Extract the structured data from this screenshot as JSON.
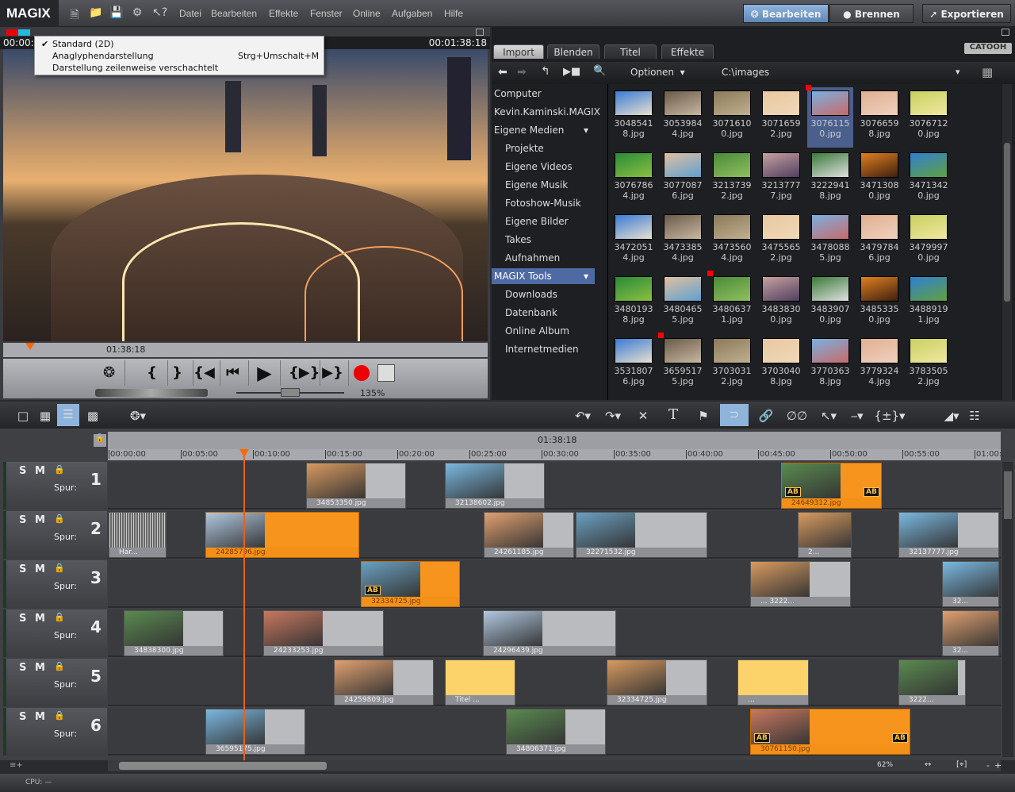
{
  "app": {
    "logo": "MAGIX"
  },
  "menu": [
    "Datei",
    "Bearbeiten",
    "Effekte",
    "Fenster",
    "Online",
    "Aufgaben",
    "Hilfe"
  ],
  "modes": {
    "edit": "Bearbeiten",
    "burn": "Brennen",
    "export": "Exportieren"
  },
  "preview": {
    "timecode_left": "00:00:0",
    "timecode_right": "00:01:38:18",
    "mini_timeline_time": "01:38:18",
    "zoom": "135%"
  },
  "stereo_menu": {
    "items": [
      {
        "label": "Standard (2D)",
        "checked": true,
        "shortcut": ""
      },
      {
        "label": "Anaglyphendarstellung",
        "checked": false,
        "shortcut": "Strg+Umschalt+M"
      },
      {
        "label": "Darstellung zeilenweise verschachtelt",
        "checked": false,
        "shortcut": ""
      }
    ]
  },
  "browser": {
    "tabs": [
      "Import",
      "Blenden",
      "Titel",
      "Effekte"
    ],
    "active_tab": "Import",
    "brand": "CATOOH",
    "options_label": "Optionen",
    "path": "C:\\images",
    "tree": [
      {
        "label": "Computer",
        "indent": 0
      },
      {
        "label": "Kevin.Kaminski.MAGIX",
        "indent": 0
      },
      {
        "label": "Eigene Medien",
        "indent": 0,
        "expand": true
      },
      {
        "label": "Projekte",
        "indent": 1
      },
      {
        "label": "Eigene Videos",
        "indent": 1
      },
      {
        "label": "Eigene Musik",
        "indent": 1
      },
      {
        "label": "Fotoshow-Musik",
        "indent": 1
      },
      {
        "label": "Eigene Bilder",
        "indent": 1
      },
      {
        "label": "Takes",
        "indent": 1
      },
      {
        "label": "Aufnahmen",
        "indent": 1
      },
      {
        "label": "MAGIX Tools",
        "indent": 0,
        "selected": true,
        "expand": true
      },
      {
        "label": "Downloads",
        "indent": 1
      },
      {
        "label": "Datenbank",
        "indent": 1
      },
      {
        "label": "Online Album",
        "indent": 1
      },
      {
        "label": "Internetmedien",
        "indent": 1
      }
    ],
    "files": [
      {
        "name": "30485418.jpg"
      },
      {
        "name": "30539844.jpg"
      },
      {
        "name": "30716100.jpg"
      },
      {
        "name": "30716592.jpg"
      },
      {
        "name": "30761150.jpg",
        "selected": true,
        "marked": true
      },
      {
        "name": "30766598.jpg"
      },
      {
        "name": "30767120.jpg"
      },
      {
        "name": "30767864.jpg"
      },
      {
        "name": "30770876.jpg"
      },
      {
        "name": "32137392.jpg"
      },
      {
        "name": "32137777.jpg"
      },
      {
        "name": "32229418.jpg"
      },
      {
        "name": "34713080.jpg"
      },
      {
        "name": "34713420.jpg"
      },
      {
        "name": "34720514.jpg"
      },
      {
        "name": "34733854.jpg"
      },
      {
        "name": "34735604.jpg"
      },
      {
        "name": "34755652.jpg"
      },
      {
        "name": "34780885.jpg"
      },
      {
        "name": "34797846.jpg"
      },
      {
        "name": "34799970.jpg"
      },
      {
        "name": "34801938.jpg"
      },
      {
        "name": "34804655.jpg"
      },
      {
        "name": "34806371.jpg",
        "marked": true
      },
      {
        "name": "34838300.jpg"
      },
      {
        "name": "34839070.jpg"
      },
      {
        "name": "34853350.jpg"
      },
      {
        "name": "34889191.jpg"
      },
      {
        "name": "35318076.jpg"
      },
      {
        "name": "36595175.jpg",
        "marked": true
      },
      {
        "name": "37030312.jpg"
      },
      {
        "name": "37030408.jpg"
      },
      {
        "name": "37703638.jpg"
      },
      {
        "name": "37793244.jpg"
      },
      {
        "name": "37835052.jpg"
      }
    ]
  },
  "timeline": {
    "marker_time": "01:38:18",
    "ruler": [
      "00:00:00",
      "00:05:00",
      "00:10:00",
      "00:15:00",
      "00:20:00",
      "00:25:00",
      "00:30:00",
      "00:35:00",
      "00:40:00",
      "00:45:00",
      "00:50:00",
      "00:55:00",
      "01:00:"
    ],
    "track_labels": {
      "solo": "S",
      "mute": "M",
      "spur": "Spur:"
    },
    "tracks": [
      {
        "number": "1",
        "clips": [
          {
            "label": "34853350.jpg"
          },
          {
            "label": "32138602.jpg"
          },
          {
            "label": "24649312.jpg",
            "ab": "AB"
          }
        ]
      },
      {
        "number": "2",
        "clips": [
          {
            "label": "Har..."
          },
          {
            "label": "24285796.jpg"
          },
          {
            "label": "24261185.jpg"
          },
          {
            "label": "32271532.jpg"
          },
          {
            "label": "2..."
          },
          {
            "label": "32137777.jpg"
          }
        ]
      },
      {
        "number": "3",
        "clips": [
          {
            "label": "32334725.jpg",
            "ab": "AB"
          },
          {
            "label": "... 3222..."
          },
          {
            "label": "32..."
          }
        ]
      },
      {
        "number": "4",
        "clips": [
          {
            "label": "34838300.jpg"
          },
          {
            "label": "24233253.jpg"
          },
          {
            "label": "24296439.jpg"
          },
          {
            "label": "32..."
          }
        ]
      },
      {
        "number": "5",
        "clips": [
          {
            "label": "24259809.jpg"
          },
          {
            "label": "Titel ..."
          },
          {
            "label": "32334725.jpg"
          },
          {
            "label": "..."
          },
          {
            "label": "3222..."
          }
        ]
      },
      {
        "number": "6",
        "clips": [
          {
            "label": "36595175.jpg"
          },
          {
            "label": "34806371.jpg"
          },
          {
            "label": "30761150.jpg",
            "ab": "AB"
          }
        ]
      }
    ],
    "zoom": "62%"
  },
  "status": {
    "cpu": "CPU: —"
  },
  "colors": {
    "accent_orange": "#f7941d",
    "selection_blue": "#4e6aa2",
    "record_red": "#e00000"
  }
}
